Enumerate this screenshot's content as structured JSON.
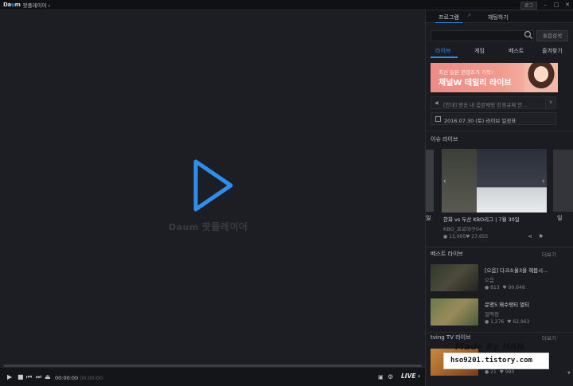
{
  "titlebar": {
    "logo_a": "D",
    "logo_b": "a",
    "logo_c": "u",
    "logo_d": "m",
    "app_name": "팟플레이어",
    "menu_caret": "▾",
    "login_label": "로그",
    "win_min": "–",
    "win_max": "□",
    "win_close": "✕"
  },
  "player": {
    "watermark_brand": "Daum",
    "watermark_name": "팟플레이어",
    "volume_level": 0.9,
    "time_current": "00:00:00",
    "time_sep": "/",
    "time_total": "00:00:00",
    "live_label": "LIVE"
  },
  "sidebar": {
    "tabs": [
      {
        "label": "프로그램"
      },
      {
        "label": "채팅하기"
      }
    ],
    "search_button": "통합검색",
    "categories": [
      {
        "label": "라이브"
      },
      {
        "label": "게임"
      },
      {
        "label": "베스트"
      },
      {
        "label": "즐겨찾기"
      }
    ],
    "banner": {
      "line1": "최신 일본 콘텐츠가 가득!",
      "line2": "채널W 데일리 라이브"
    },
    "notice": {
      "text": "[안내] 방송 내 음란채팅 강경규제 안...",
      "more": "∨"
    },
    "schedule": {
      "text": "2016.07.30 (토) 라이브 일정표"
    },
    "issue_live": {
      "heading": "이슈 라이브",
      "left_peek": "일",
      "right_peek": "일",
      "card": {
        "title": "한화 vs 두산 KBO리그 | 7월 30일",
        "channel": "KBO_프로야구04",
        "viewers": "13,995",
        "likes": "27,655"
      }
    },
    "best_live": {
      "heading": "베스트 라이브",
      "more": "더보기",
      "items": [
        {
          "title": "[으음] 다크소울3을 해봅시...",
          "channel": "으음",
          "viewers": "813",
          "likes": "90,648"
        },
        {
          "title": "문명5 왜수탱티 멀티",
          "channel": "얼떡정",
          "viewers": "1,276",
          "likes": "62,963"
        }
      ]
    },
    "tving": {
      "heading": "tving TV 라이브",
      "more": "더보기",
      "viewers": "21",
      "likes": "980"
    }
  },
  "overlay": {
    "made_by": "Made By HAN",
    "blog": "hso9201.tistory.com"
  },
  "colors": {
    "accent": "#2e8ef0",
    "bg_dark": "#17181c",
    "player_bg": "#1d1e23"
  }
}
